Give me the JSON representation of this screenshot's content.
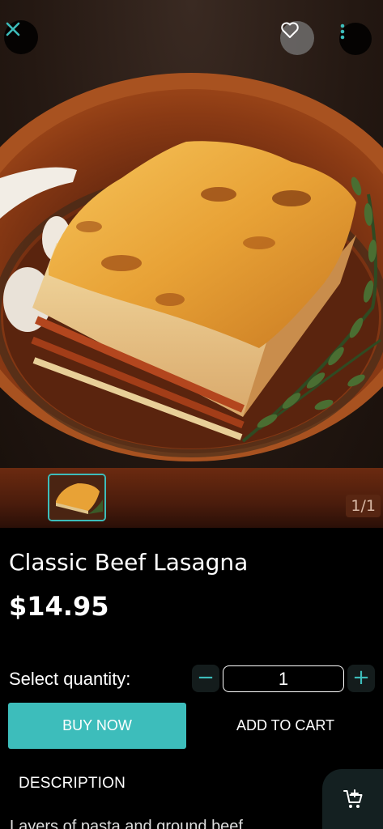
{
  "product": {
    "title": "Classic Beef Lasagna",
    "price": "$14.95"
  },
  "gallery": {
    "counter": "1/1",
    "accent_color": "#3dbdbb"
  },
  "actions": {
    "close_icon": "close-icon",
    "favorite_icon": "heart-outline-icon",
    "more_icon": "more-vertical-icon"
  },
  "quantity": {
    "label": "Select quantity:",
    "value": "1",
    "minus": "−",
    "plus": "+"
  },
  "buttons": {
    "buy_now": "BUY NOW",
    "add_to_cart": "ADD TO CART"
  },
  "tabs": {
    "description": "DESCRIPTION"
  },
  "description": {
    "text_partial": "Layers of pasta and ground beef"
  },
  "fab": {
    "icon": "add-to-cart-icon"
  }
}
